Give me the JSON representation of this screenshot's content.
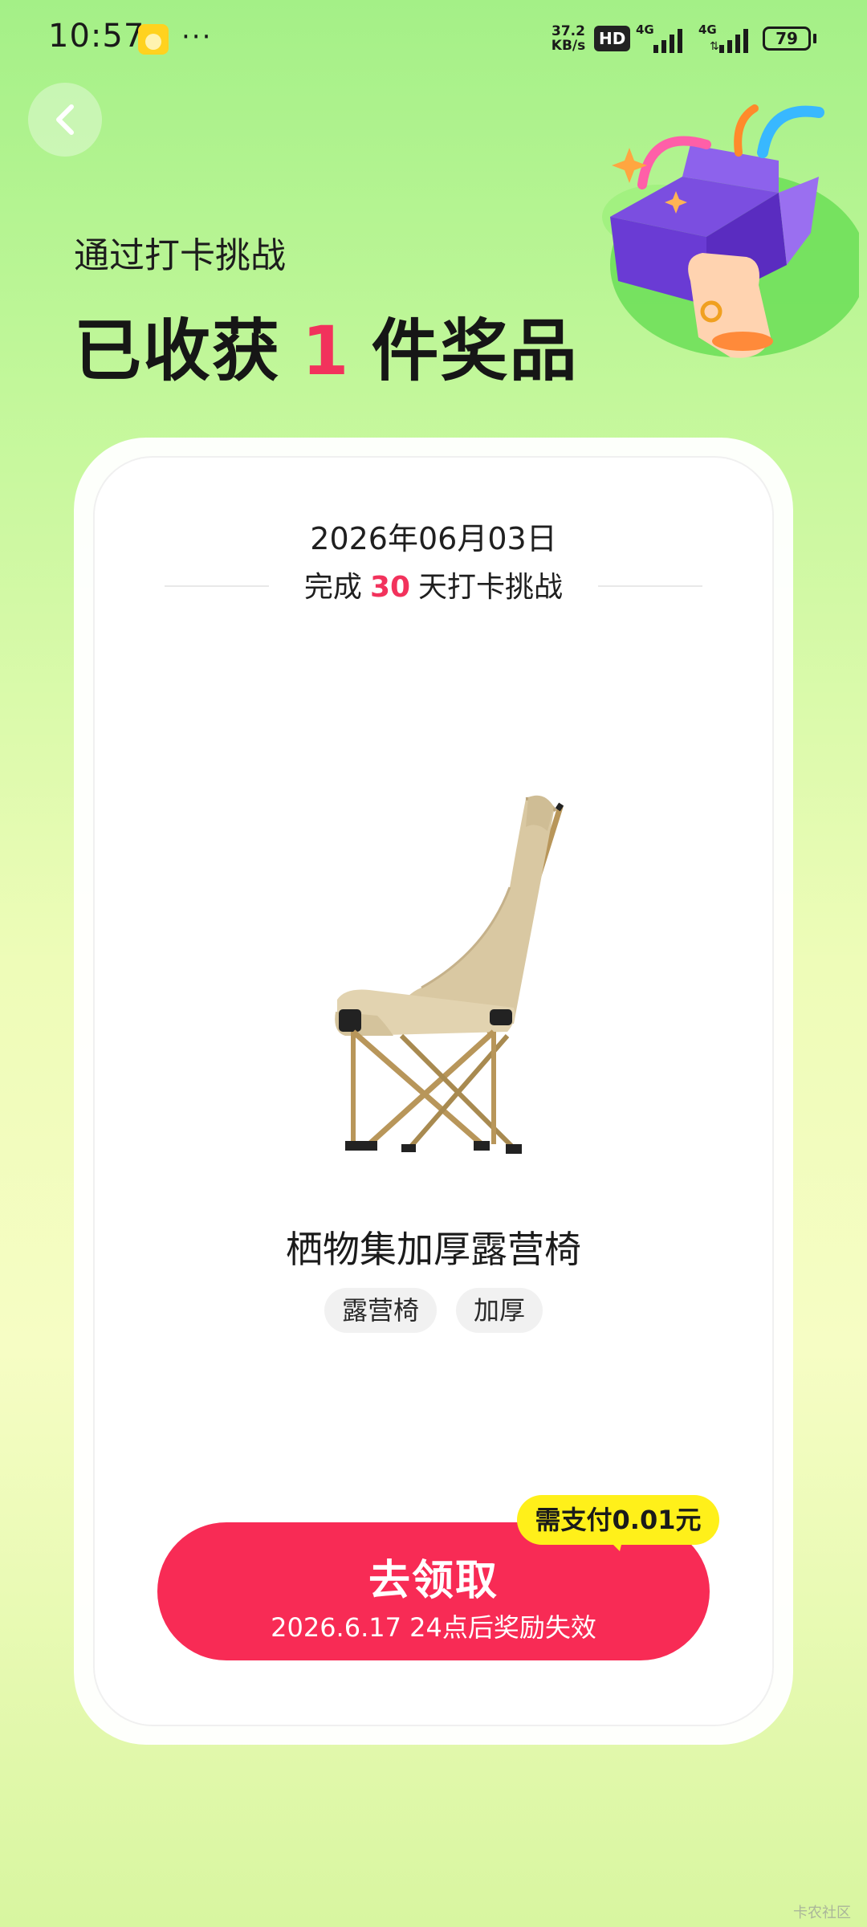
{
  "status_bar": {
    "time": "10:57",
    "more": "···",
    "speed_value": "37.2",
    "speed_unit": "KB/s",
    "hd": "HD",
    "network1": "4G",
    "network2": "4G",
    "battery": "79"
  },
  "header": {
    "subtitle": "通过打卡挑战",
    "headline_prefix": "已收获",
    "headline_count": "1",
    "headline_suffix": "件奖品"
  },
  "card": {
    "date": "2026年06月03日",
    "challenge_prefix": "完成",
    "challenge_days": "30",
    "challenge_suffix": "天打卡挑战",
    "product_name": "栖物集加厚露营椅",
    "tags": [
      "露营椅",
      "加厚"
    ],
    "price_badge": "需支付0.01元",
    "claim_label": "去领取",
    "claim_deadline": "2026.6.17 24点后奖励失效"
  },
  "watermark": "卡农社区",
  "colors": {
    "accent": "#f2325c",
    "button": "#f82b55",
    "badge": "#fff01a"
  }
}
